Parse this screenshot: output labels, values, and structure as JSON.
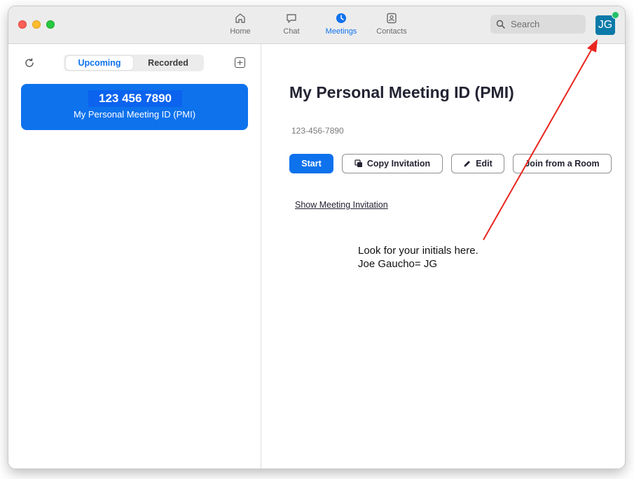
{
  "nav": {
    "home": "Home",
    "chat": "Chat",
    "meetings": "Meetings",
    "contacts": "Contacts"
  },
  "search": {
    "placeholder": "Search"
  },
  "avatar": {
    "initials": "JG"
  },
  "tabs": {
    "upcoming": "Upcoming",
    "recorded": "Recorded"
  },
  "card": {
    "id": "123 456 7890",
    "name": "My Personal Meeting ID (PMI)"
  },
  "detail": {
    "title": "My Personal Meeting ID (PMI)",
    "number": "123-456-7890",
    "start": "Start",
    "copy": "Copy Invitation",
    "edit": "Edit",
    "room": "Join from a Room",
    "show": "Show Meeting Invitation"
  },
  "annotation": {
    "line1": "Look for your initials here.",
    "line2": "Joe Gaucho= JG"
  },
  "colors": {
    "accent": "#0e72ed",
    "arrow": "#e8261f",
    "status": "#23c168",
    "avatar_bg": "#0b7aa8"
  }
}
